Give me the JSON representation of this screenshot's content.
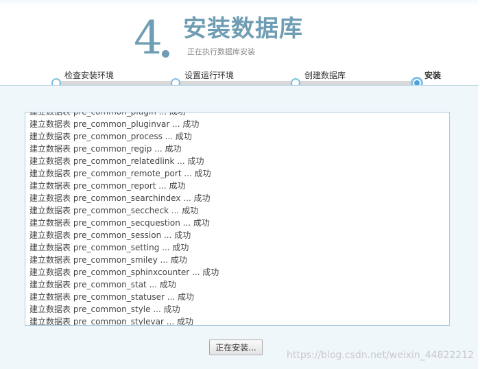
{
  "header": {
    "step_number": "4",
    "title": "安装数据库",
    "subtitle": "正在执行数据库安装"
  },
  "steps": [
    {
      "label": "检查安装环境",
      "state": "done"
    },
    {
      "label": "设置运行环境",
      "state": "done"
    },
    {
      "label": "创建数据库",
      "state": "done"
    },
    {
      "label": "安装",
      "state": "current"
    }
  ],
  "log": {
    "lines": [
      "建立数据表 pre_common_plugin ... 成功",
      "建立数据表 pre_common_pluginvar ... 成功",
      "建立数据表 pre_common_process ... 成功",
      "建立数据表 pre_common_regip ... 成功",
      "建立数据表 pre_common_relatedlink ... 成功",
      "建立数据表 pre_common_remote_port ... 成功",
      "建立数据表 pre_common_report ... 成功",
      "建立数据表 pre_common_searchindex ... 成功",
      "建立数据表 pre_common_seccheck ... 成功",
      "建立数据表 pre_common_secquestion ... 成功",
      "建立数据表 pre_common_session ... 成功",
      "建立数据表 pre_common_setting ... 成功",
      "建立数据表 pre_common_smiley ... 成功",
      "建立数据表 pre_common_sphinxcounter ... 成功",
      "建立数据表 pre_common_stat ... 成功",
      "建立数据表 pre_common_statuser ... 成功",
      "建立数据表 pre_common_style ... 成功",
      "建立数据表 pre_common_stylevar ... 成功"
    ]
  },
  "actions": {
    "install_button_label": "正在安装..."
  },
  "watermark": "https://blog.csdn.net/weixin_44822212",
  "colors": {
    "accent": "#6f9db3",
    "step_ring": "#7fbfe0",
    "step_active": "#4aa3dc",
    "panel_bg": "#f0f7fb",
    "log_border": "#a9cbd9"
  }
}
